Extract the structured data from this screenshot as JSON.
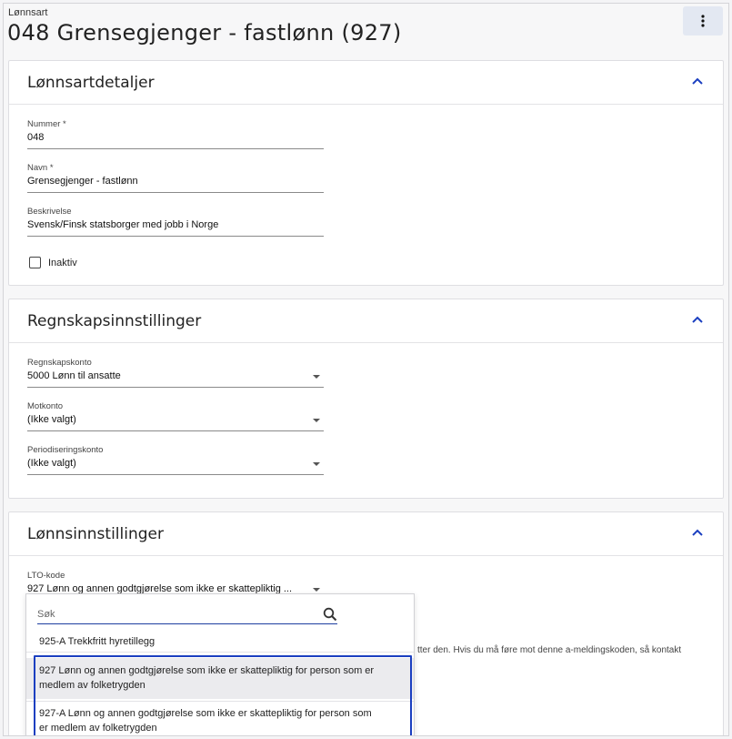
{
  "header": {
    "breadcrumb": "Lønnsart",
    "title": "048 Grensegjenger - fastlønn (927)",
    "more_icon": "more-vertical-icon"
  },
  "colors": {
    "accent": "#1b3fc0",
    "highlight_bg": "#ebebee"
  },
  "sections": {
    "details": {
      "title": "Lønnsartdetaljer",
      "fields": {
        "nummer": {
          "label": "Nummer *",
          "value": "048"
        },
        "navn": {
          "label": "Navn *",
          "value": "Grensegjenger - fastlønn"
        },
        "beskrivelse": {
          "label": "Beskrivelse",
          "value": "Svensk/Finsk statsborger med jobb i Norge"
        }
      },
      "inaktiv_label": "Inaktiv"
    },
    "accounting": {
      "title": "Regnskapsinnstillinger",
      "fields": {
        "regnskapskonto": {
          "label": "Regnskapskonto",
          "value": "5000 Lønn til ansatte"
        },
        "motkonto": {
          "label": "Motkonto",
          "value": "(Ikke valgt)"
        },
        "periodisering": {
          "label": "Periodiseringskonto",
          "value": "(Ikke valgt)"
        }
      }
    },
    "salary": {
      "title": "Lønnsinnstillinger",
      "lto": {
        "label": "LTO-kode",
        "value": "927 Lønn og annen godtgjørelse som ikke er skattepliktig ..."
      },
      "note_fragment": "tter den. Hvis du må føre mot denne a-meldingskoden, så kontakt"
    }
  },
  "dropdown": {
    "search_placeholder": "Søk",
    "options": [
      {
        "line1": "925-A Trekkfritt hyretillegg"
      },
      {
        "line1": "927 Lønn og annen godtgjørelse som ikke er skattepliktig for person som er",
        "line2": "medlem av folketrygden"
      },
      {
        "line1": "927-A Lønn og annen godtgjørelse som ikke er skattepliktig for person som",
        "line2": "er medlem av folketrygden"
      }
    ]
  }
}
